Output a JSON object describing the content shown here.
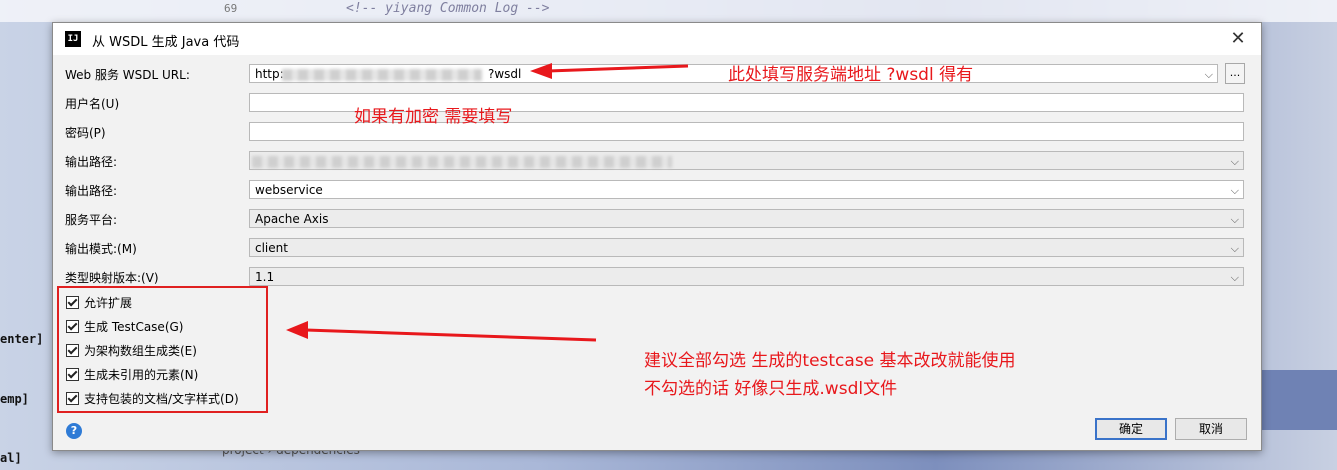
{
  "background": {
    "line_number": "69",
    "code_comment": "<!-- yiyang Common Log -->",
    "side_labels": [
      "enter]",
      "emp]",
      "al]"
    ],
    "breadcrumb": "project  ›  dependencies"
  },
  "dialog": {
    "title": "从 WSDL 生成 Java 代码",
    "app_icon": "IJ",
    "close_icon": "close-icon",
    "fields": {
      "wsdl_url": {
        "label": "Web 服务 WSDL URL:",
        "value_prefix": "http:",
        "value_suffix": "?wsdl"
      },
      "username": {
        "label": "用户名(U)",
        "value": ""
      },
      "password": {
        "label": "密码(P)",
        "value": ""
      },
      "output_path_1": {
        "label": "输出路径:"
      },
      "output_path_2": {
        "label": "输出路径:",
        "value": "webservice"
      },
      "platform": {
        "label": "服务平台:",
        "value": "Apache Axis"
      },
      "output_mode": {
        "label": "输出模式:(M)",
        "value": "client"
      },
      "type_mapping": {
        "label": "类型映射版本:(V)",
        "value": "1.1"
      }
    },
    "browse_label": "...",
    "checkboxes": [
      {
        "label": "允许扩展",
        "checked": true
      },
      {
        "label": "生成 TestCase(G)",
        "checked": true
      },
      {
        "label": "为架构数组生成类(E)",
        "checked": true
      },
      {
        "label": "生成未引用的元素(N)",
        "checked": true
      },
      {
        "label": "支持包装的文档/文字样式(D)",
        "checked": true
      }
    ],
    "help_label": "?",
    "ok_label": "确定",
    "cancel_label": "取消"
  },
  "annotations": {
    "url_note": "此处填写服务端地址  ?wsdl 得有",
    "password_note": "如果有加密 需要填写",
    "checkbox_note_line1": "建议全部勾选 生成的testcase 基本改改就能使用",
    "checkbox_note_line2": "不勾选的话 好像只生成.wsdl文件",
    "color": "#e8181c"
  }
}
